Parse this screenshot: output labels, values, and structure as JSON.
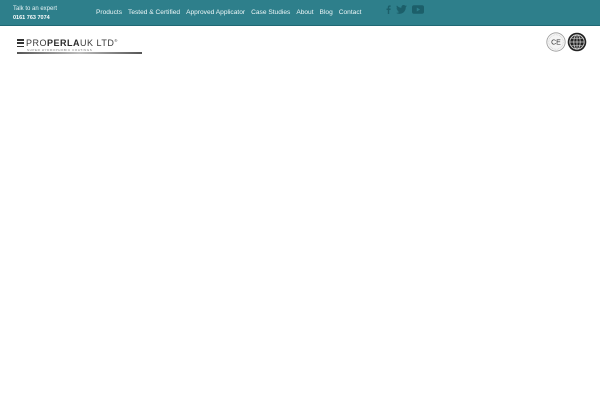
{
  "header": {
    "contact": {
      "label": "Talk to an expert",
      "phone": "0161 763 7074"
    },
    "nav": [
      {
        "label": "Products"
      },
      {
        "label": "Tested & Certified"
      },
      {
        "label": "Approved Applicator"
      },
      {
        "label": "Case Studies"
      },
      {
        "label": "About"
      },
      {
        "label": "Blog"
      },
      {
        "label": "Contact"
      }
    ],
    "social": [
      "facebook-icon",
      "twitter-icon",
      "youtube-icon"
    ]
  },
  "logo": {
    "prefix": "PRO",
    "name": "PERLA",
    "suffix": "UK LTD",
    "registered": "®",
    "tagline": "SUPER HYDROPHOBIC COATINGS"
  },
  "badges": [
    {
      "name": "ce-mark-icon",
      "text": "CE"
    },
    {
      "name": "globe-certification-icon"
    }
  ],
  "colors": {
    "topbar": "#2e7f8b",
    "social": "#1c5f6a"
  }
}
